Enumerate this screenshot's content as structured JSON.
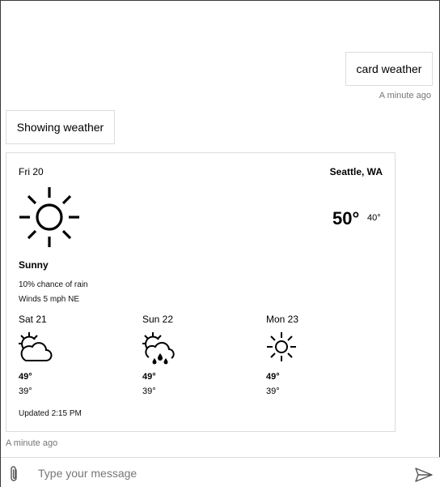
{
  "conversation": {
    "user_message": {
      "text": "card weather",
      "timestamp": "A minute ago"
    },
    "bot_message": {
      "text": "Showing weather",
      "timestamp": "A minute ago"
    }
  },
  "weather_card": {
    "date": "Fri 20",
    "location": "Seattle, WA",
    "icon": "sun-icon",
    "temperature": "50°",
    "low": "40°",
    "condition": "Sunny",
    "rain_chance": "10% chance of rain",
    "winds": "Winds 5 mph NE",
    "forecast": [
      {
        "day": "Sat 21",
        "icon": "partly-cloudy-icon",
        "high": "49°",
        "low": "39°"
      },
      {
        "day": "Sun 22",
        "icon": "rain-cloud-icon",
        "high": "49°",
        "low": "39°"
      },
      {
        "day": "Mon 23",
        "icon": "sun-icon",
        "high": "49°",
        "low": "39°"
      }
    ],
    "updated": "Updated 2:15 PM"
  },
  "composer": {
    "placeholder": "Type your message",
    "attach_icon": "paperclip-icon",
    "send_icon": "send-icon"
  },
  "colors": {
    "text": "#000000",
    "muted": "#767676",
    "border": "#dcdcdc"
  }
}
